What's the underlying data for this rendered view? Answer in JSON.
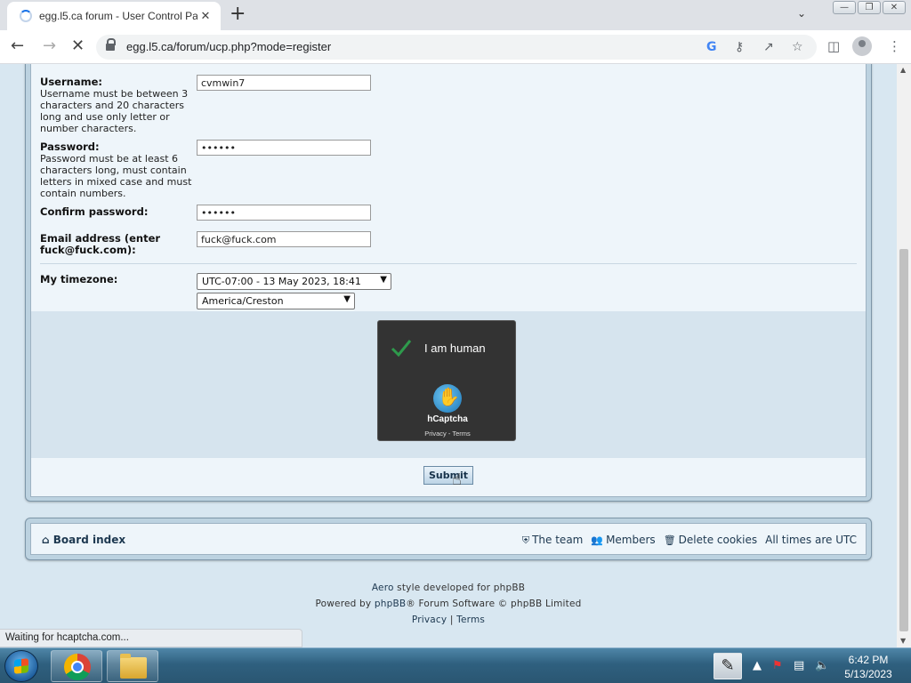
{
  "browser": {
    "tab_title": "egg.l5.ca forum - User Control Pa",
    "tab_close": "✕",
    "new_tab": "+",
    "url": "egg.l5.ca/forum/ucp.php?mode=register",
    "status_text": "Waiting for hcaptcha.com..."
  },
  "form": {
    "username_label": "Username:",
    "username_hint": "Username must be between 3 characters and 20 characters long and use only letter or number characters.",
    "username_value": "cvmwin7",
    "password_label": "Password:",
    "password_hint": "Password must be at least 6 characters long, must contain letters in mixed case and must contain numbers.",
    "password_value": "••••••",
    "confirm_label": "Confirm password:",
    "confirm_value": "••••••",
    "email_label": "Email address (enter fuck@fuck.com):",
    "email_value": "fuck@fuck.com",
    "timezone_label": "My timezone:",
    "timezone_offset": "UTC-07:00 - 13 May 2023, 18:41",
    "timezone_zone": "America/Creston",
    "submit_label": "Submit"
  },
  "captcha": {
    "text": "I am human",
    "brand": "hCaptcha",
    "links": "Privacy - Terms"
  },
  "navbar": {
    "board_index": "Board index",
    "the_team": "The team",
    "members": "Members",
    "delete_cookies": "Delete cookies",
    "timezone_note": "All times are UTC"
  },
  "footer": {
    "line1_style": "Aero",
    "line1_rest": " style developed for phpBB",
    "line2_pre": "Powered by ",
    "line2_link": "phpBB",
    "line2_rest": "® Forum Software © phpBB Limited",
    "privacy": "Privacy",
    "separator": "|",
    "terms": "Terms"
  },
  "taskbar": {
    "time": "6:42 PM",
    "date": "5/13/2023"
  }
}
